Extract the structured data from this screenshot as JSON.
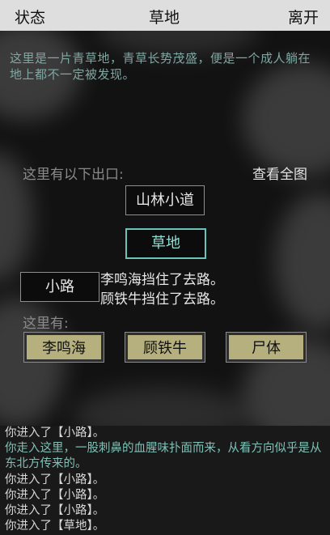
{
  "header": {
    "status_label": "状态",
    "title": "草地",
    "leave_label": "离开"
  },
  "room": {
    "description": "这里是一片青草地，青草长势茂盛，便是一个成人躺在地上都不一定被发现。",
    "exits_label": "这里有以下出口:",
    "full_map_label": "查看全图",
    "exits": {
      "north": "山林小道",
      "current": "草地",
      "west": "小路"
    },
    "block_notes": [
      "李鸣海挡住了去路。",
      "顾铁牛挡住了去路。"
    ],
    "here_label": "这里有:",
    "entities": [
      "李鸣海",
      "顾铁牛",
      "尸体"
    ]
  },
  "log": [
    {
      "text": "你进入了【小路】。",
      "color": "normal"
    },
    {
      "text": "你走入这里，一股刺鼻的血腥味扑面而来，从看方向似乎是从东北方传来的。",
      "color": "cyan"
    },
    {
      "text": "你进入了【小路】。",
      "color": "normal"
    },
    {
      "text": "你进入了【小路】。",
      "color": "normal"
    },
    {
      "text": "你进入了【小路】。",
      "color": "normal"
    },
    {
      "text": "你进入了【草地】。",
      "color": "normal"
    }
  ],
  "colors": {
    "background": "#121212",
    "description_text": "#7fa8a3",
    "current_room_border": "#6cc4b9",
    "npc_button": "#b5b07e"
  }
}
